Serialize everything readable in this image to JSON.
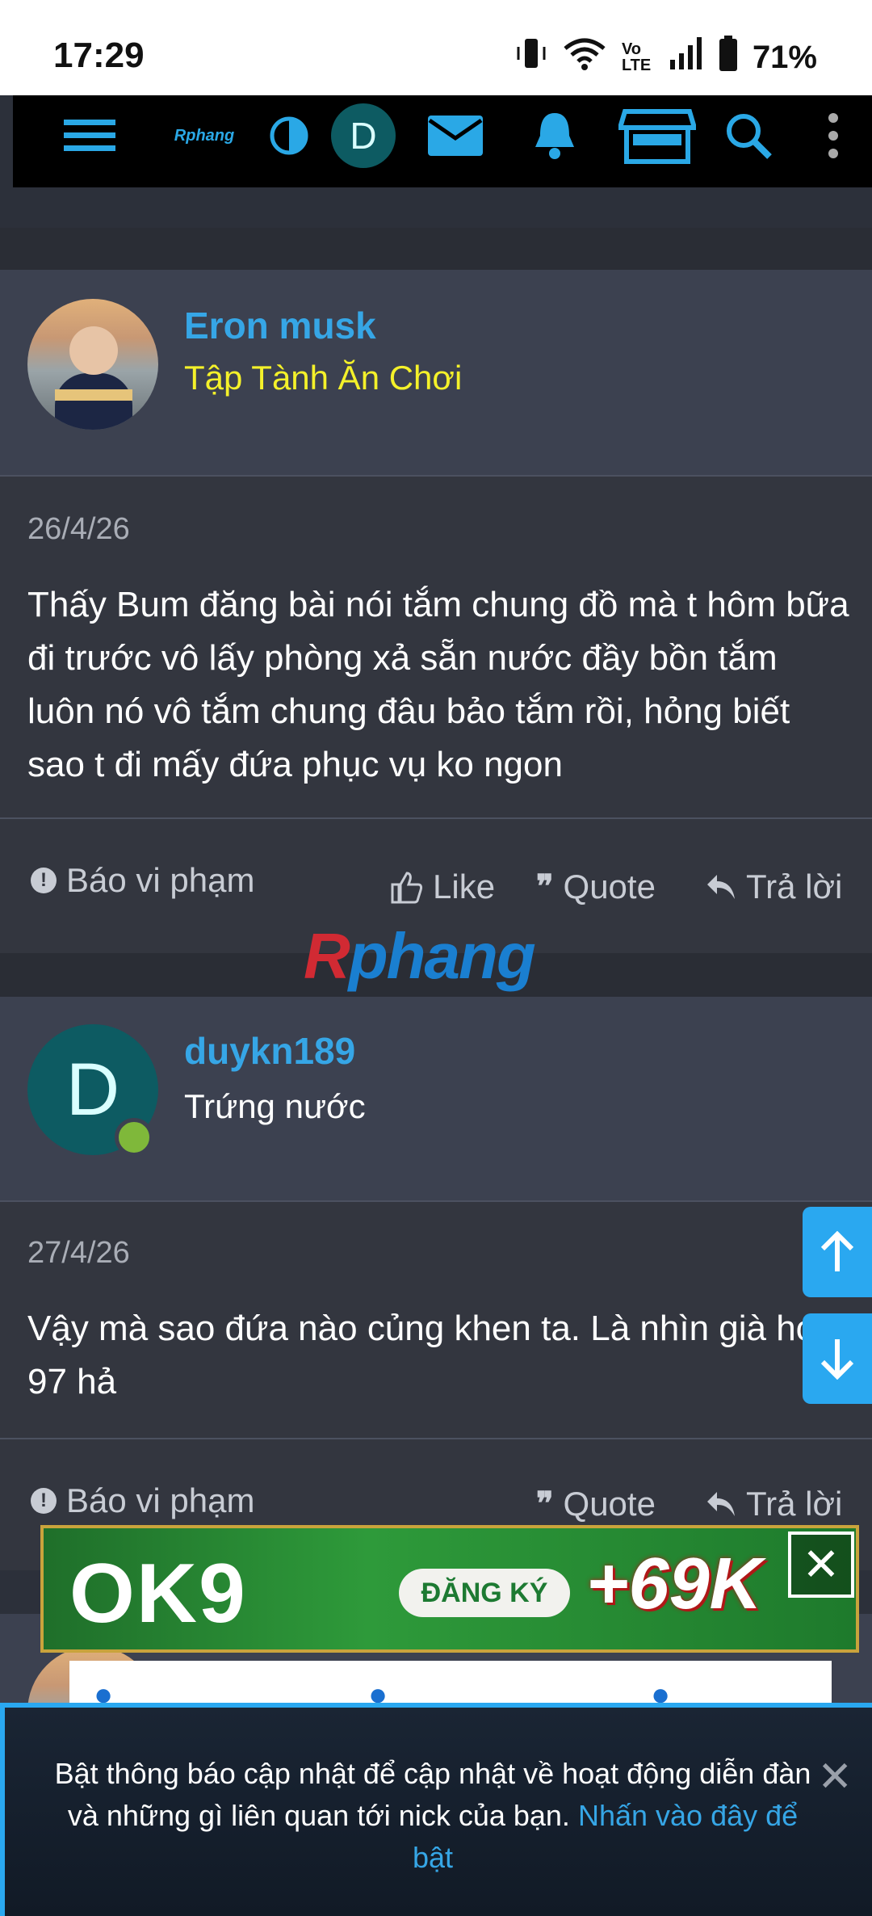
{
  "status_bar": {
    "time": "17:29",
    "network": "Vo LTE",
    "battery": "71%"
  },
  "nav": {
    "logo": "Rphang",
    "avatar_letter": "D"
  },
  "posts": [
    {
      "username": "Eron musk",
      "user_title": "Tập Tành Ăn Chơi",
      "date": "26/4/26",
      "body": "Thấy Bum đăng bài nói tắm chung đồ mà t hôm bữa đi trước vô lấy phòng xả sẵn nước đầy bồn tắm luôn nó vô tắm chung đâu bảo tắm rồi, hỏng biết sao t đi mấy đứa phục vụ ko ngon",
      "actions": {
        "report": "Báo vi phạm",
        "like": "Like",
        "quote": "Quote",
        "reply": "Trả lời"
      }
    },
    {
      "username": "duykn189",
      "user_title": "Trứng nước",
      "avatar_letter": "D",
      "date": "27/4/26",
      "body": "Vậy mà sao đứa nào củng khen ta. Là nhìn già hơn 97 hả",
      "actions": {
        "report": "Báo vi phạm",
        "quote": "Quote",
        "reply": "Trả lời"
      }
    }
  ],
  "watermark": {
    "part_a": "R",
    "part_b": "phang"
  },
  "ad": {
    "logo": "OK9",
    "register": "ĐĂNG KÝ",
    "bonus": "+69K"
  },
  "notice": {
    "text": "Bật thông báo cập nhật để cập nhật về hoạt động diễn đàn và những gì liên quan tới nick của bạn.",
    "link": "Nhấn vào đây để bật"
  },
  "colors": {
    "accent": "#36a6e6",
    "user_title_rank": "#f4f12a",
    "background": "#2c303a",
    "header": "#3c4150"
  }
}
